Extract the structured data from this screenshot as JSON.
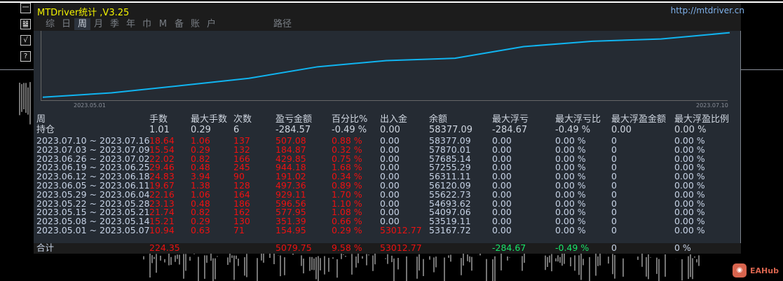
{
  "window": {
    "title": "MTDriver统计 ,V3.25",
    "url": "http://mtdriver.cn"
  },
  "side_icons": [
    "一",
    "䷄",
    "√",
    "?"
  ],
  "tabs": [
    {
      "label": "综"
    },
    {
      "label": "日"
    },
    {
      "label": "周",
      "active": true
    },
    {
      "label": "月"
    },
    {
      "label": "季"
    },
    {
      "label": "年"
    },
    {
      "label": "巾"
    },
    {
      "label": "M"
    },
    {
      "label": "备"
    },
    {
      "label": "账"
    },
    {
      "label": "户"
    },
    {
      "label": "路径"
    }
  ],
  "chart": {
    "start_label": "2023.05.01",
    "end_label": "2023.07.10",
    "line_color": "#10b4f0"
  },
  "table": {
    "headers": [
      "周",
      "手数",
      "最大手数",
      "次数",
      "盈亏金额",
      "百分比%",
      "出入金",
      "余额",
      "最大浮亏",
      "最大浮亏比",
      "最大浮盈金额",
      "最大浮盈比例"
    ],
    "holding": {
      "label": "持仓",
      "values": [
        "1.01",
        "0.29",
        "6",
        "-284.57",
        "-0.49 %",
        "0.00",
        "58377.09",
        "-284.67",
        "-0.49 %",
        "0.00",
        "0.00 %"
      ]
    },
    "rows": [
      [
        "2023.07.10 ~ 2023.07.16",
        "18.64",
        "1.06",
        "137",
        "507.08",
        "0.88 %",
        "0.00",
        "58377.09",
        "0.00",
        "0.00 %",
        "0",
        "0.00 %"
      ],
      [
        "2023.07.03 ~ 2023.07.09",
        "15.54",
        "0.29",
        "132",
        "184.87",
        "0.32 %",
        "0.00",
        "57870.01",
        "0.00",
        "0.00 %",
        "0",
        "0.00 %"
      ],
      [
        "2023.06.26 ~ 2023.07.02",
        "22.02",
        "0.82",
        "166",
        "429.85",
        "0.75 %",
        "0.00",
        "57685.14",
        "0.00",
        "0.00 %",
        "0",
        "0.00 %"
      ],
      [
        "2023.06.19 ~ 2023.06.25",
        "29.46",
        "0.48",
        "245",
        "944.18",
        "1.68 %",
        "0.00",
        "57255.29",
        "0.00",
        "0.00 %",
        "0",
        "0.00 %"
      ],
      [
        "2023.06.12 ~ 2023.06.18",
        "24.83",
        "3.94",
        "90",
        "191.02",
        "0.34 %",
        "0.00",
        "56311.11",
        "0.00",
        "0.00 %",
        "0",
        "0.00 %"
      ],
      [
        "2023.06.05 ~ 2023.06.11",
        "19.67",
        "1.38",
        "128",
        "497.36",
        "0.89 %",
        "0.00",
        "56120.09",
        "0.00",
        "0.00 %",
        "0",
        "0.00 %"
      ],
      [
        "2023.05.29 ~ 2023.06.04",
        "22.16",
        "1.06",
        "164",
        "929.11",
        "1.70 %",
        "0.00",
        "55622.73",
        "0.00",
        "0.00 %",
        "0",
        "0.00 %"
      ],
      [
        "2023.05.22 ~ 2023.05.28",
        "23.13",
        "0.48",
        "186",
        "596.56",
        "1.10 %",
        "0.00",
        "54693.62",
        "0.00",
        "0.00 %",
        "0",
        "0.00 %"
      ],
      [
        "2023.05.15 ~ 2023.05.21",
        "21.74",
        "0.82",
        "162",
        "577.95",
        "1.08 %",
        "0.00",
        "54097.06",
        "0.00",
        "0.00 %",
        "0",
        "0.00 %"
      ],
      [
        "2023.05.08 ~ 2023.05.14",
        "15.21",
        "0.29",
        "130",
        "351.39",
        "0.66 %",
        "0.00",
        "53519.11",
        "0.00",
        "0.00 %",
        "0",
        "0.00 %"
      ],
      [
        "2023.05.01 ~ 2023.05.07",
        "10.94",
        "0.63",
        "71",
        "154.95",
        "0.29 %",
        "53012.77",
        "53167.72",
        "0.00",
        "0.00 %",
        "0",
        "0.00 %"
      ]
    ],
    "total": {
      "label": "合计",
      "values": [
        "224.35",
        "",
        "",
        "5079.75",
        "9.58 %",
        "53012.77",
        "",
        "-284.67",
        "-0.49 %",
        "0",
        "0 %"
      ]
    }
  },
  "watermark": {
    "text": "EAHub"
  }
}
